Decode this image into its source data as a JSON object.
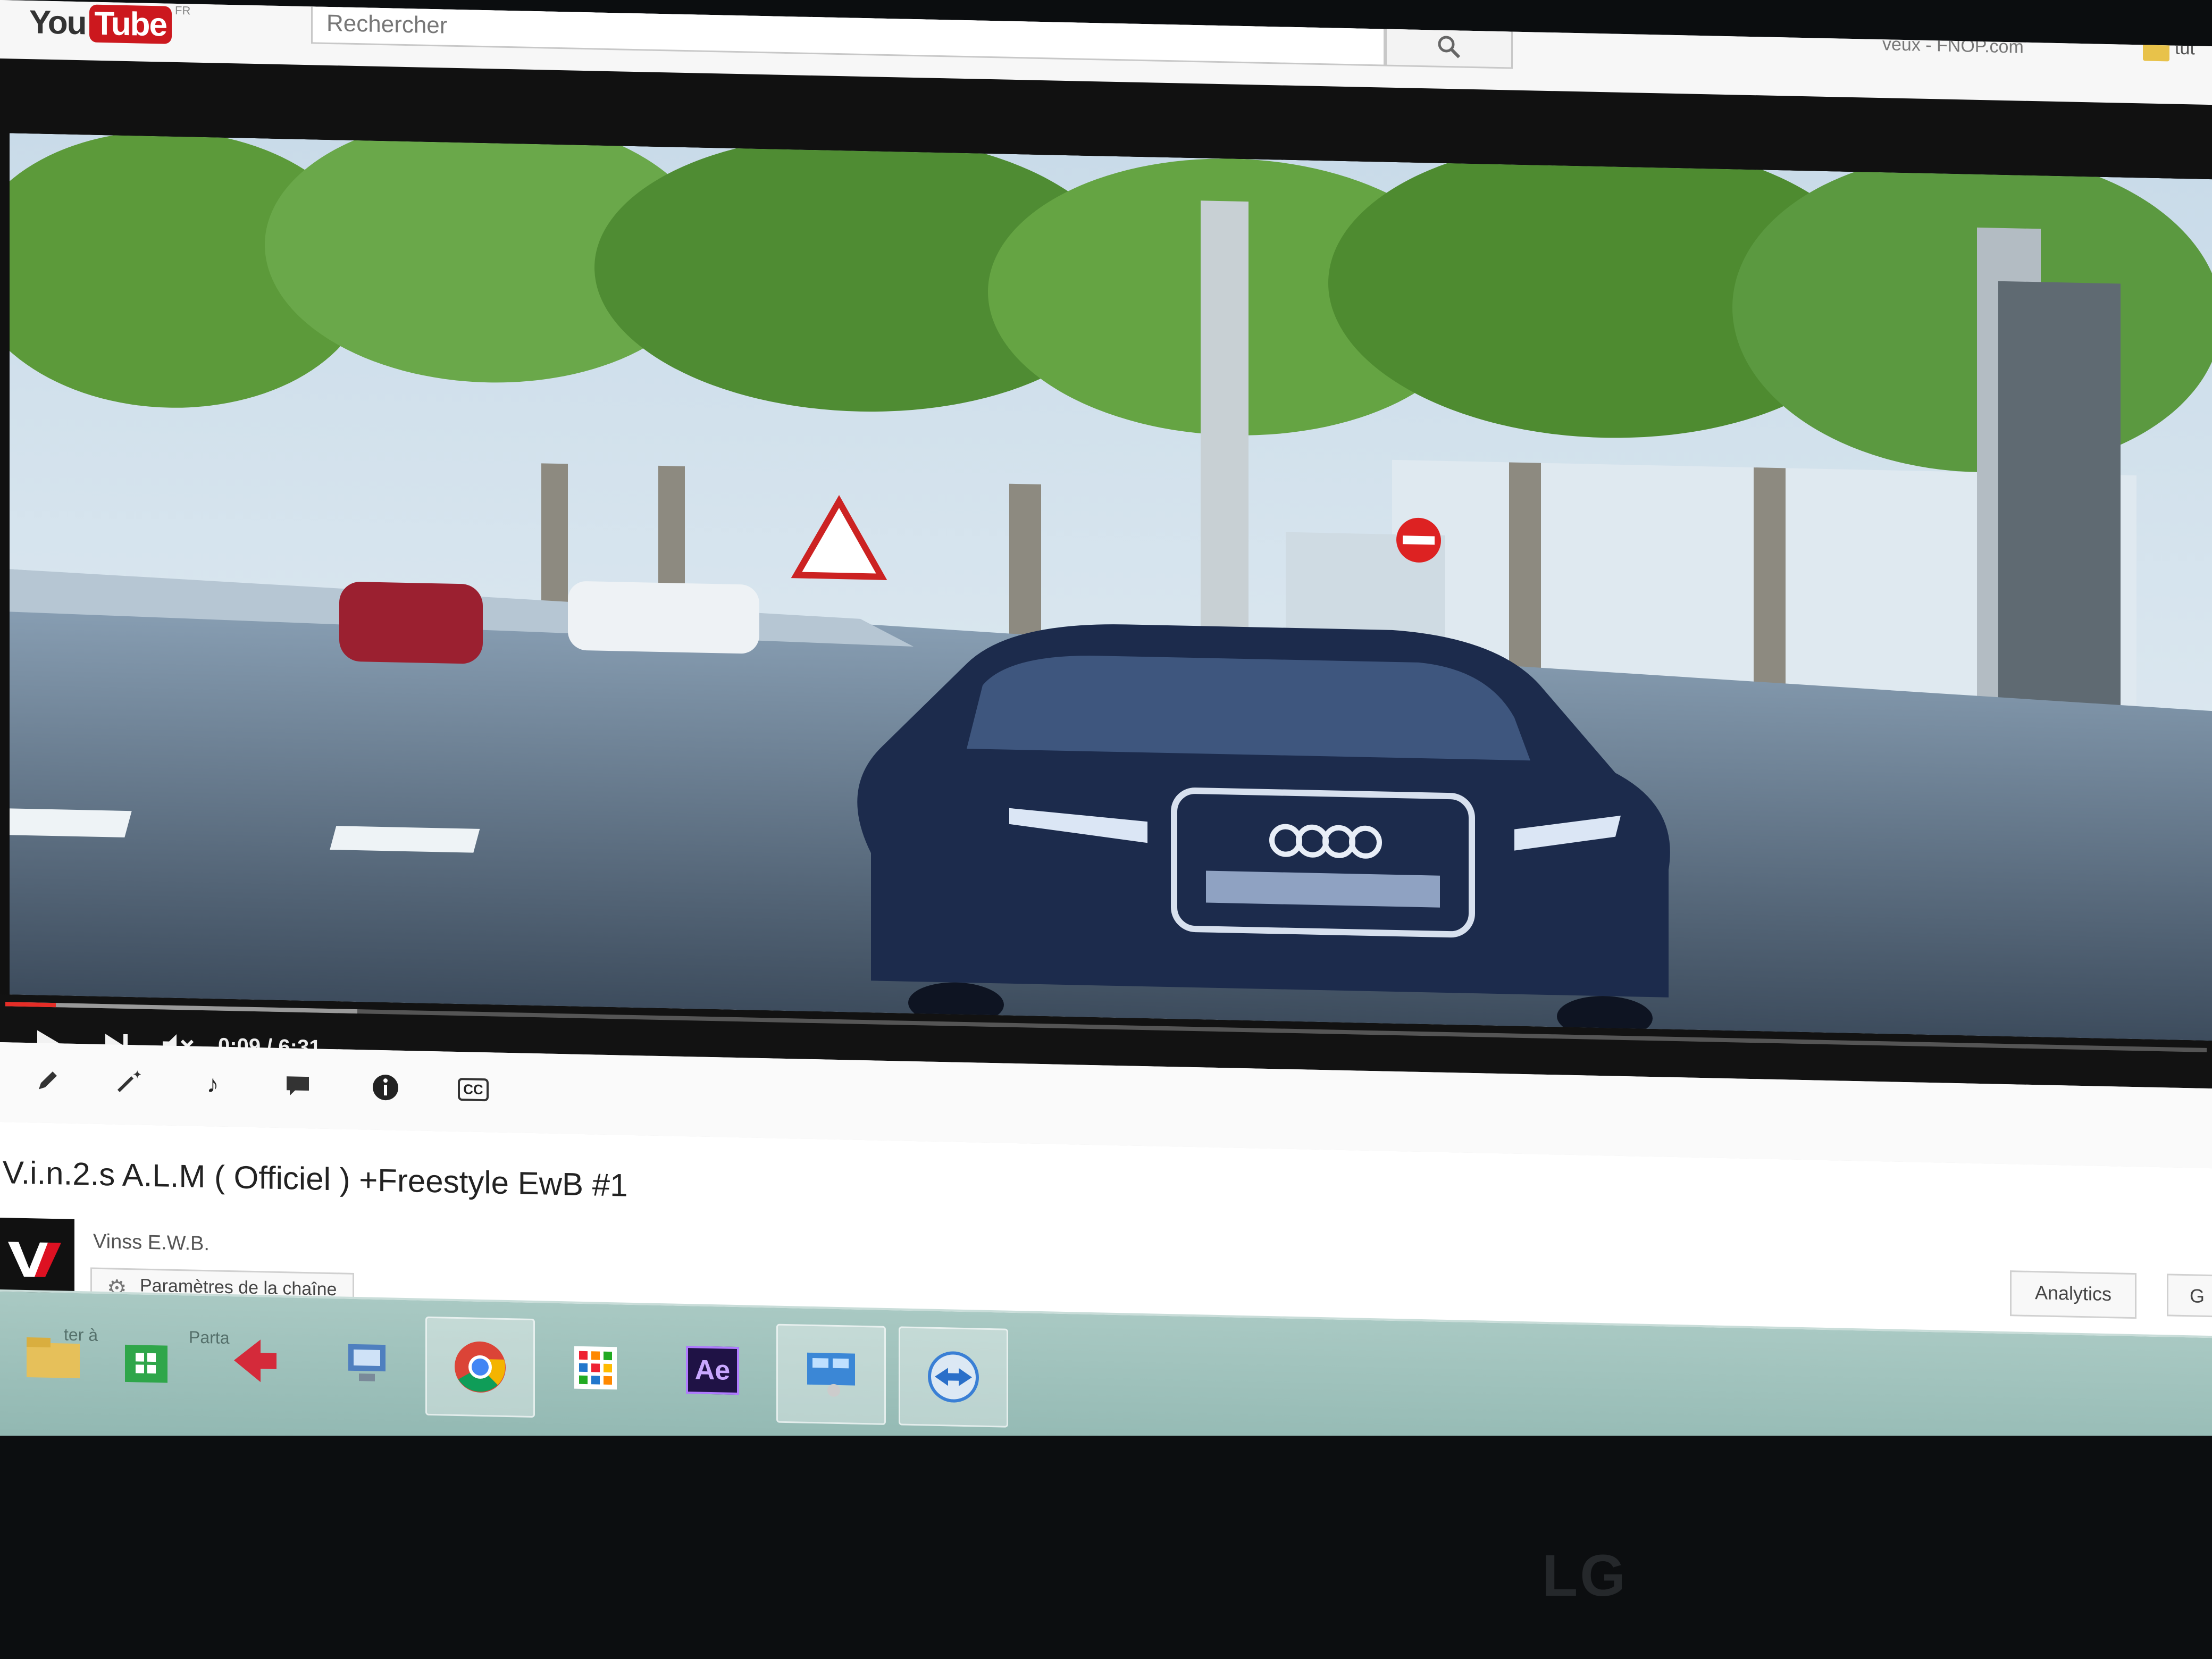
{
  "header": {
    "logo_you": "You",
    "logo_tube": "Tube",
    "logo_region": "FR",
    "search_placeholder": "Rechercher",
    "right_text": "veux - FNOP.com",
    "folder_label": "tut"
  },
  "player": {
    "current_time": "0:09",
    "duration": "6:31",
    "time_display": "0:09 / 6:31",
    "progress_fraction": 0.023,
    "buffered_fraction": 0.16,
    "muted": true,
    "video_scene_description_icon": "video-frame"
  },
  "toolbar": {
    "tools": [
      "pencil-icon",
      "magic-wand-icon",
      "music-note-icon",
      "comment-icon",
      "info-icon",
      "cc-icon"
    ],
    "cc_label": "CC"
  },
  "video": {
    "title": "V.i.n.2.s A.L.M ( Officiel ) +Freestyle EwB #1",
    "channel_name": "Vinss E.W.B.",
    "channel_settings_label": "Paramètres de la chaîne",
    "analytics_label": "Analytics",
    "more_label": "G"
  },
  "taskbar": {
    "ghost_label_1": "ter à",
    "ghost_label_2": "Parta",
    "ae_label": "Ae",
    "apps": [
      "file-explorer-icon",
      "store-icon",
      "app-arrow-icon",
      "network-icon",
      "chrome-icon",
      "apps-grid-icon",
      "after-effects-icon",
      "remote-desktop-icon",
      "teamviewer-icon"
    ]
  },
  "monitor": {
    "brand": "LG"
  },
  "colors": {
    "youtube_red": "#cc181e",
    "progress_red": "#e52d27",
    "taskbar": "#9fc2bc"
  }
}
